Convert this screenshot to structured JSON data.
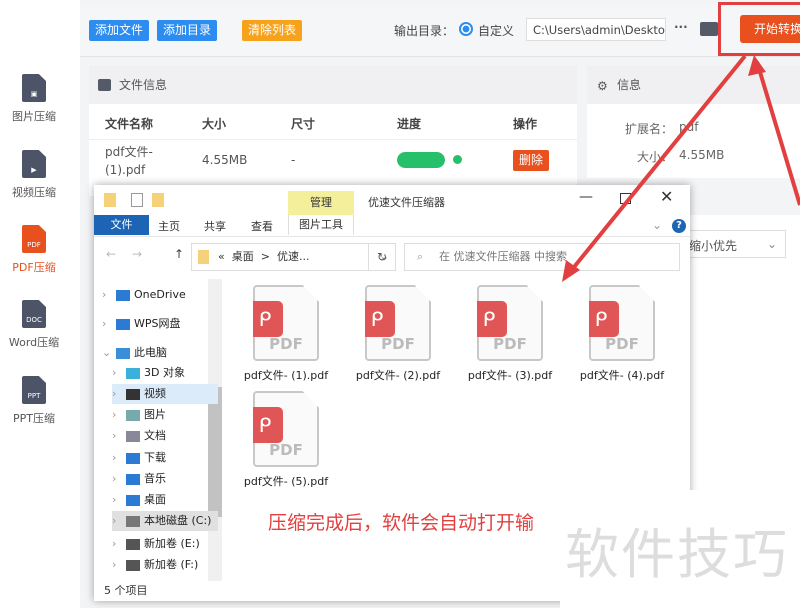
{
  "sidebar": {
    "items": [
      {
        "label": "图片压缩",
        "icon": ""
      },
      {
        "label": "视频压缩",
        "icon": "▶"
      },
      {
        "label": "PDF压缩",
        "icon": "PDF"
      },
      {
        "label": "Word压缩",
        "icon": "DOC"
      },
      {
        "label": "PPT压缩",
        "icon": "PPT"
      }
    ]
  },
  "toolbar": {
    "add_file": "添加文件",
    "add_dir": "添加目录",
    "clear_list": "清除列表",
    "output_label": "输出目录：",
    "radio_label": "自定义",
    "output_path": "C:\\Users\\admin\\Deskto",
    "more": "···",
    "start": "开始转换"
  },
  "file_panel": {
    "title": "文件信息",
    "columns": [
      "文件名称",
      "大小",
      "尺寸",
      "进度",
      "操作"
    ],
    "rows": [
      {
        "name": "pdf文件-(1).pdf",
        "size": "4.55MB",
        "dims": "-",
        "progress": 1.0,
        "action": "删除"
      }
    ]
  },
  "info_panel": {
    "title": "信息",
    "ext_label": "扩展名：",
    "ext_value": "pdf",
    "size_label": "大小：",
    "size_value": "4.55MB",
    "mode": "缩小优先"
  },
  "explorer": {
    "title": "优速文件压缩器",
    "manage_tab": "管理",
    "picture_tools": "图片工具",
    "ribbon_tabs": [
      "文件",
      "主页",
      "共享",
      "查看"
    ],
    "breadcrumb": [
      "«",
      "桌面",
      ">",
      "优速..."
    ],
    "search_placeholder": "在 优速文件压缩器 中搜索",
    "tree": [
      "OneDrive",
      "WPS网盘",
      "此电脑",
      "3D 对象",
      "视频",
      "图片",
      "文档",
      "下载",
      "音乐",
      "桌面",
      "本地磁盘 (C:)",
      "新加卷 (E:)",
      "新加卷 (F:)"
    ],
    "files": [
      "pdf文件- (1).pdf",
      "pdf文件- (2).pdf",
      "pdf文件- (3).pdf",
      "pdf文件- (4).pdf",
      "pdf文件- (5).pdf"
    ],
    "pdf_label": "PDF",
    "status": "5 个项目"
  },
  "annotation": "压缩完成后，软件会自动打开输",
  "watermark": "软件技巧",
  "colors": {
    "blue": "#2d8cf0",
    "orange": "#f7a21b",
    "red": "#e8501e",
    "green": "#27c06a"
  }
}
